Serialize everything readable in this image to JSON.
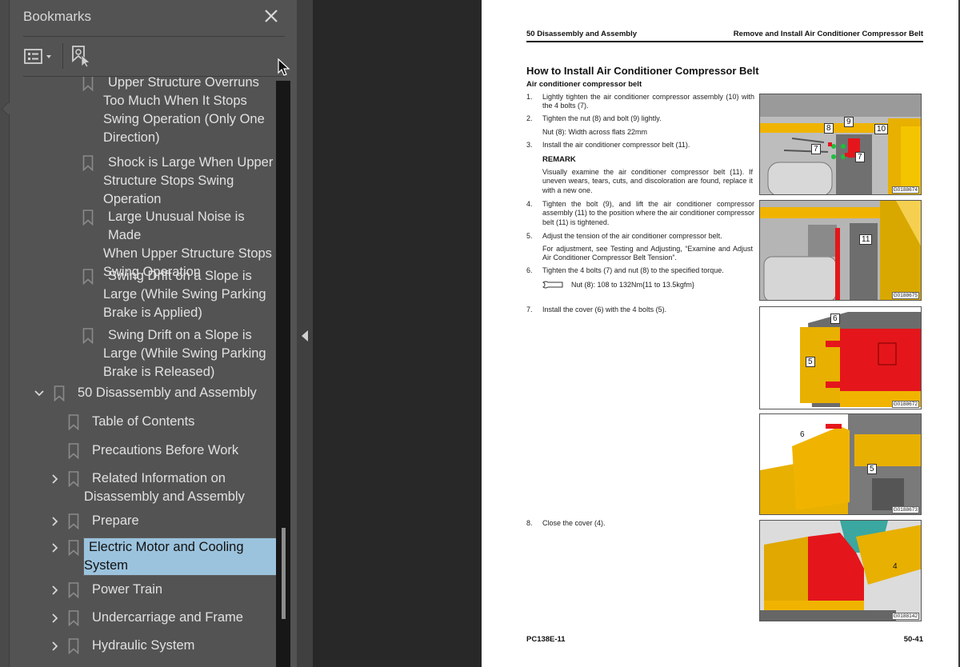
{
  "bookmarks_panel": {
    "title": "Bookmarks",
    "close_icon": "close-icon",
    "toolbar": {
      "options_icon": "list-options-icon",
      "find_icon": "find-current-bookmark-icon"
    },
    "items": [
      {
        "label": "Upper Structure Overruns Too Much When It Stops Swing Operation (Only One Direction)",
        "level": 3,
        "expandable": false,
        "lines": [
          "Upper Structure Overruns",
          "Too Much When It Stops",
          "Swing Operation (Only One",
          "Direction)"
        ]
      },
      {
        "label": "Shock is Large When Upper Structure Stops Swing Operation",
        "level": 3,
        "expandable": false,
        "lines": [
          "Shock is Large When Upper",
          "Structure Stops Swing",
          "Operation"
        ]
      },
      {
        "label": "Large Unusual Noise is Made When Upper Structure Stops Swing Operation",
        "level": 3,
        "expandable": false,
        "lines": [
          "Large Unusual Noise is Made",
          "When Upper Structure Stops",
          "Swing Operation"
        ]
      },
      {
        "label": "Swing Drift on a Slope is Large (While Swing Parking Brake is Applied)",
        "level": 3,
        "expandable": false,
        "lines": [
          "Swing Drift on a Slope is",
          "Large (While Swing Parking",
          "Brake is Applied)"
        ]
      },
      {
        "label": "Swing Drift on a Slope is Large (While Swing Parking Brake is Released)",
        "level": 3,
        "expandable": false,
        "lines": [
          "Swing Drift on a Slope is",
          "Large (While Swing Parking",
          "Brake is Released)"
        ]
      },
      {
        "label": "50 Disassembly and Assembly",
        "level": 1,
        "expandable": true,
        "expanded": true,
        "lines": [
          "50 Disassembly and Assembly"
        ]
      },
      {
        "label": "Table of Contents",
        "level": 2,
        "expandable": false,
        "lines": [
          "Table of Contents"
        ]
      },
      {
        "label": "Precautions Before Work",
        "level": 2,
        "expandable": false,
        "lines": [
          "Precautions Before Work"
        ]
      },
      {
        "label": "Related Information on Disassembly and Assembly",
        "level": 2,
        "expandable": true,
        "expanded": false,
        "lines": [
          "Related Information on",
          "Disassembly and Assembly"
        ]
      },
      {
        "label": "Prepare",
        "level": 2,
        "expandable": true,
        "expanded": false,
        "lines": [
          "Prepare"
        ]
      },
      {
        "label": "Electric Motor and Cooling System",
        "level": 2,
        "expandable": true,
        "expanded": false,
        "selected": true,
        "lines": [
          "Electric Motor and Cooling",
          "System"
        ]
      },
      {
        "label": "Power Train",
        "level": 2,
        "expandable": true,
        "expanded": false,
        "lines": [
          "Power Train"
        ]
      },
      {
        "label": "Undercarriage and Frame",
        "level": 2,
        "expandable": true,
        "expanded": false,
        "lines": [
          "Undercarriage and Frame"
        ]
      },
      {
        "label": "Hydraulic System",
        "level": 2,
        "expandable": true,
        "expanded": false,
        "lines": [
          "Hydraulic System"
        ]
      }
    ],
    "selection_color": "#9cc3dd"
  },
  "collapse_panel_icon": "triangle-left-icon",
  "document": {
    "header_left": "50 Disassembly and Assembly",
    "header_right": "Remove and Install Air Conditioner Compressor Belt",
    "title": "How to Install Air Conditioner Compressor Belt",
    "subtitle": "Air conditioner compressor belt",
    "steps": [
      {
        "num": "1.",
        "text": "Lightly tighten the air conditioner compressor assembly (10) with the 4 bolts (7)."
      },
      {
        "num": "2.",
        "text": "Tighten the nut (8) and bolt (9) lightly."
      },
      {
        "num": "3.",
        "text": "Install the air conditioner compressor belt (11)."
      },
      {
        "num": "4.",
        "text": "Tighten the bolt (9), and lift the air conditioner compressor assembly (11) to the position where the air conditioner compressor belt (11) is tightened."
      },
      {
        "num": "5.",
        "text": "Adjust the tension of the air conditioner compressor belt."
      },
      {
        "num": "6.",
        "text": "Tighten the 4 bolts (7) and nut (8) to the specified torque."
      },
      {
        "num": "7.",
        "text": "Install the cover (6) with the 4 bolts (5)."
      },
      {
        "num": "8.",
        "text": "Close the cover (4)."
      }
    ],
    "step2_note": "Nut (8): Width across flats 22mm",
    "remark_label": "REMARK",
    "remark_text": "Visually examine the air conditioner compressor belt (11). If uneven wears, tears, cuts, and discoloration are found, replace it with a new one.",
    "step5_note": "For adjustment, see Testing and Adjusting, “Examine and Adjust Air Conditioner Compressor Belt Tension”.",
    "torque_icon": "wrench-icon",
    "torque_spec": "Nut (8): 108 to 132Nm{11 to 13.5kgfm}",
    "figures": [
      {
        "code": "G0188674",
        "callouts": [
          "8",
          "9",
          "10",
          "7",
          "7"
        ]
      },
      {
        "code": "G0188675",
        "callouts": [
          "11"
        ]
      },
      {
        "code": "G0188672",
        "callouts": [
          "6",
          "5"
        ]
      },
      {
        "code": "G0188673",
        "callouts": [
          "6",
          "5"
        ]
      },
      {
        "code": "G0188142",
        "callouts": [
          "4"
        ]
      }
    ],
    "footer_left": "PC138E-11",
    "footer_right": "50-41",
    "accent_colors": {
      "machine_yellow": "#f0b400",
      "highlight_red": "#e4161b"
    }
  }
}
